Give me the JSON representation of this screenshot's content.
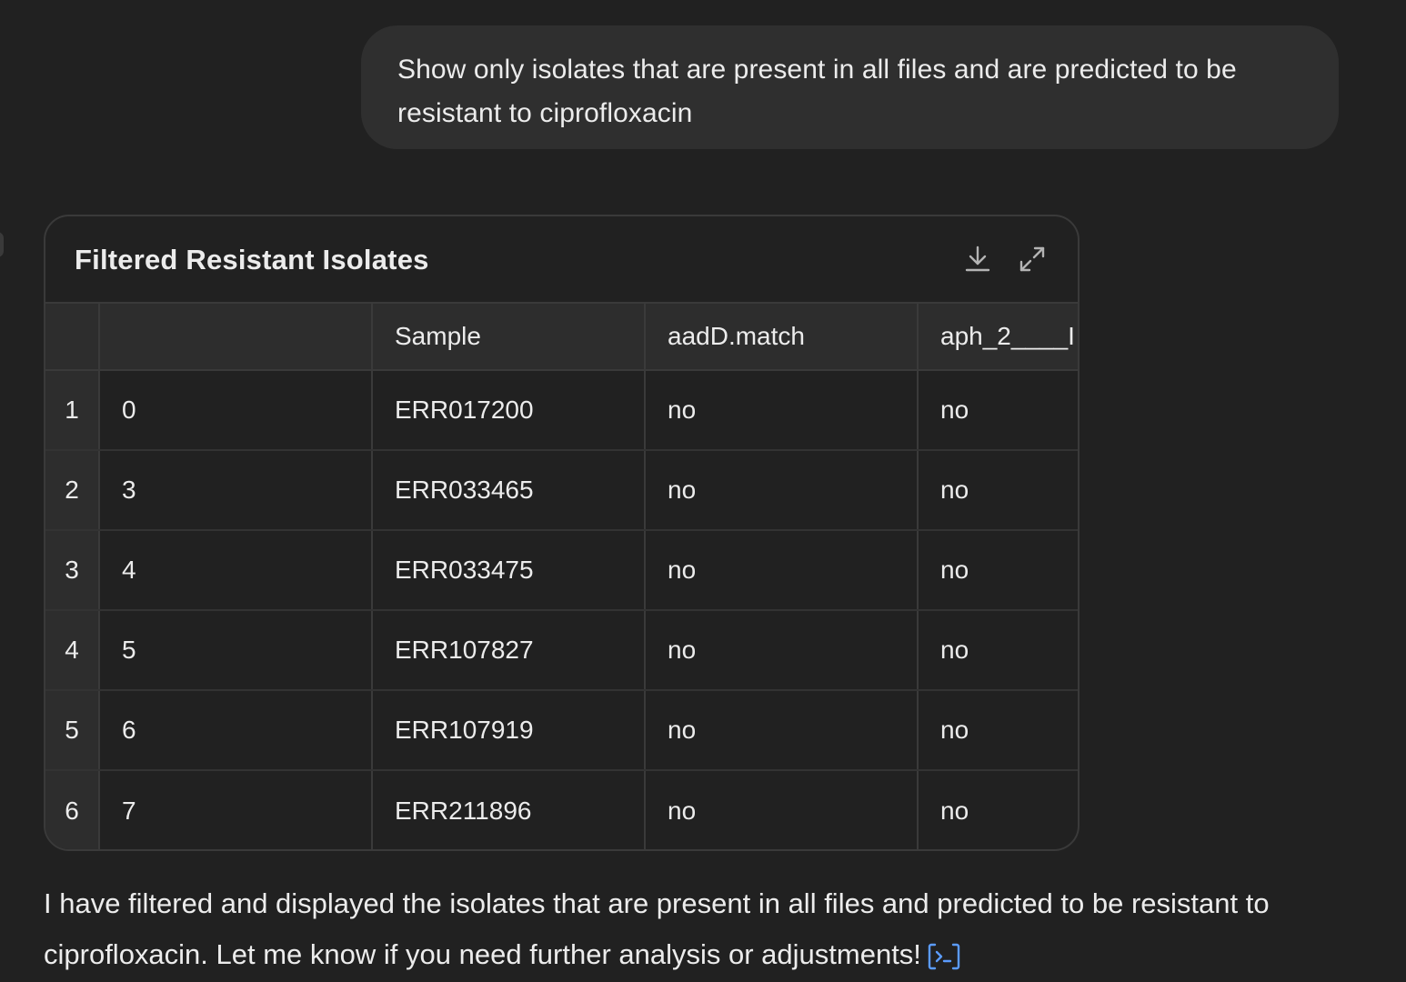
{
  "user_message": "Show only isolates that are present in all files and are predicted to be resistant to ciprofloxacin",
  "table": {
    "title": "Filtered Resistant Isolates",
    "icons": {
      "download": "download-icon",
      "expand": "expand-icon"
    },
    "columns": [
      "",
      "",
      "Sample",
      "aadD.match",
      "aph_2____I"
    ],
    "rows": [
      {
        "rownum": "1",
        "index": "0",
        "sample": "ERR017200",
        "aadD": "no",
        "aph": "no"
      },
      {
        "rownum": "2",
        "index": "3",
        "sample": "ERR033465",
        "aadD": "no",
        "aph": "no"
      },
      {
        "rownum": "3",
        "index": "4",
        "sample": "ERR033475",
        "aadD": "no",
        "aph": "no"
      },
      {
        "rownum": "4",
        "index": "5",
        "sample": "ERR107827",
        "aadD": "no",
        "aph": "no"
      },
      {
        "rownum": "5",
        "index": "6",
        "sample": "ERR107919",
        "aadD": "no",
        "aph": "no"
      },
      {
        "rownum": "6",
        "index": "7",
        "sample": "ERR211896",
        "aadD": "no",
        "aph": "no"
      }
    ]
  },
  "assistant_message": "I have filtered and displayed the isolates that are present in all files and predicted to be resistant to ciprofloxacin. Let me know if you need further analysis or adjustments!",
  "code_link_icon": "code-interpreter-icon",
  "colors": {
    "background": "#212121",
    "bubble": "#2f2f2f",
    "border": "#3a3a3a",
    "text": "#ececec",
    "link_accent": "#5b9bff"
  }
}
